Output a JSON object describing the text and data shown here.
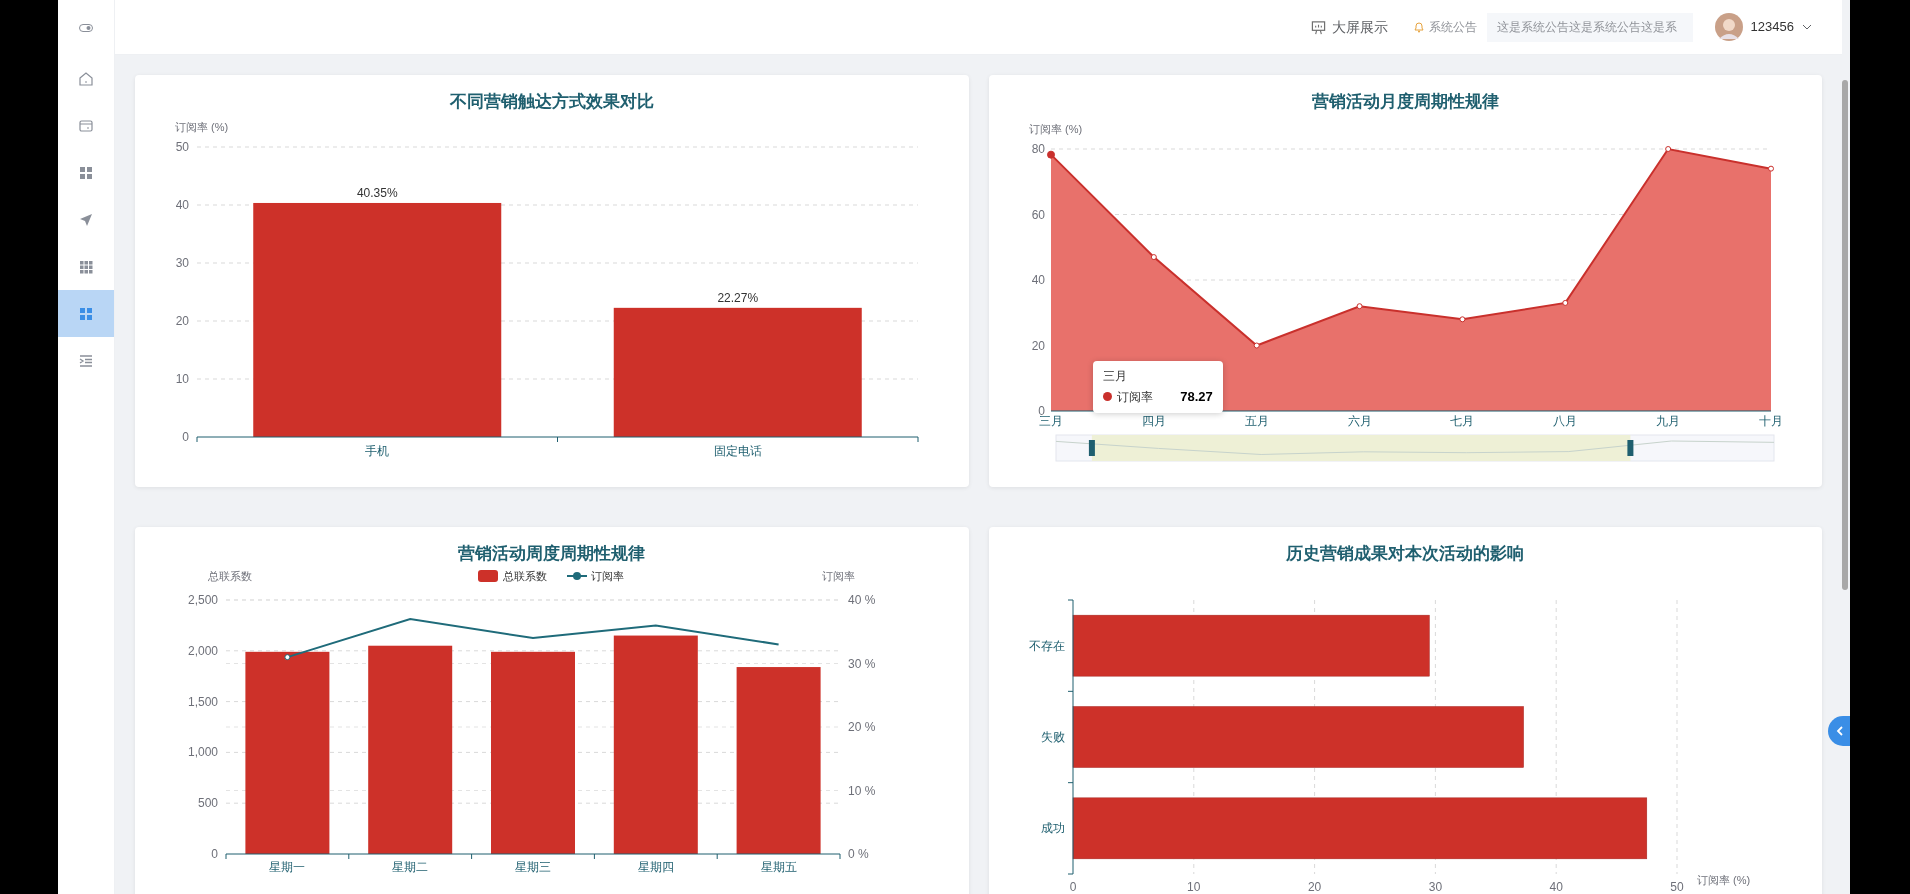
{
  "sidebar": {
    "items": [
      {
        "kind": "home",
        "selected": false
      },
      {
        "kind": "card",
        "selected": false
      },
      {
        "kind": "grid",
        "selected": false
      },
      {
        "kind": "plane",
        "selected": false
      },
      {
        "kind": "grid9",
        "selected": false
      },
      {
        "kind": "grid",
        "selected": true
      },
      {
        "kind": "indent",
        "selected": false
      }
    ]
  },
  "header": {
    "big_screen": "大屏展示",
    "notice_label": "系统公告",
    "notice_text": "这是系统公告这是系统公告这是系",
    "username": "123456"
  },
  "charts": [
    {
      "title": "不同营销触达方式效果对比",
      "chart_data": {
        "type": "bar",
        "grid": true,
        "ylabel": "订阅率 (%)",
        "categories": [
          "手机",
          "固定电话"
        ],
        "values": [
          40.35,
          22.27
        ],
        "ylim": [
          0,
          50
        ],
        "yticks": [
          0,
          10,
          20,
          30,
          40,
          50
        ],
        "value_labels": [
          "40.35%",
          "22.27%"
        ]
      }
    },
    {
      "title": "营销活动月度周期性规律",
      "chart_data": {
        "type": "area",
        "grid": true,
        "ylabel": "订阅率 (%)",
        "categories": [
          "三月",
          "四月",
          "五月",
          "六月",
          "七月",
          "八月",
          "九月",
          "十月"
        ],
        "series": [
          {
            "color": "#c9302c",
            "values": [
              78.27,
              47,
              20,
              32,
              28,
              33,
              80,
              74
            ]
          }
        ],
        "ylim": [
          0,
          80
        ],
        "yticks": [
          0,
          20,
          40,
          60,
          80
        ]
      },
      "tooltip": {
        "title": "三月",
        "name": "订阅率",
        "value": "78.27"
      },
      "zoom": {
        "start": {
          "level": 0.05
        },
        "end": {
          "level": 0.8
        }
      }
    },
    {
      "title": "营销活动周度周期性规律",
      "chart_data": {
        "type": "bar",
        "grid": true,
        "legend": "top",
        "ylabel": "总联系数",
        "categories": [
          "星期一",
          "星期二",
          "星期三",
          "星期四",
          "星期五"
        ],
        "series": [
          {
            "name": "总联系数",
            "type": "bar",
            "color": "#cd3129",
            "values": [
              1990,
              2050,
              1990,
              2150,
              1840
            ]
          },
          {
            "name": "订阅率",
            "type": "line",
            "axis": "y2",
            "color": "#1f6b7a",
            "values": [
              31,
              37,
              34,
              36,
              33
            ]
          }
        ],
        "ylim": [
          0,
          2500
        ],
        "yticks": [
          {
            "value": 0,
            "label": "0"
          },
          {
            "value": 500,
            "label": "500"
          },
          {
            "value": 1000,
            "label": "1,000"
          },
          {
            "value": 1500,
            "label": "1,500"
          },
          {
            "value": 2000,
            "label": "2,000"
          },
          {
            "value": 2500,
            "label": "2,500"
          }
        ],
        "y2label": "订阅率",
        "y2lim": [
          0,
          40
        ],
        "y2ticks": [
          {
            "value": 0,
            "label": "0 %"
          },
          {
            "value": 10,
            "label": "10 %"
          },
          {
            "value": 20,
            "label": "20 %"
          },
          {
            "value": 30,
            "label": "30 %"
          },
          {
            "value": 40,
            "label": "40 %"
          }
        ]
      }
    },
    {
      "title": "历史营销成果对本次活动的影响",
      "chart_data": {
        "type": "bar",
        "grid": true,
        "orientation": "horizontal",
        "xlabel": "订阅率 (%)",
        "categories": [
          "不存在",
          "失败",
          "成功"
        ],
        "values": [
          29.5,
          37.3,
          47.5
        ],
        "xlim": [
          0,
          50
        ],
        "xticks": [
          0,
          10,
          20,
          30,
          40,
          50
        ]
      }
    }
  ]
}
